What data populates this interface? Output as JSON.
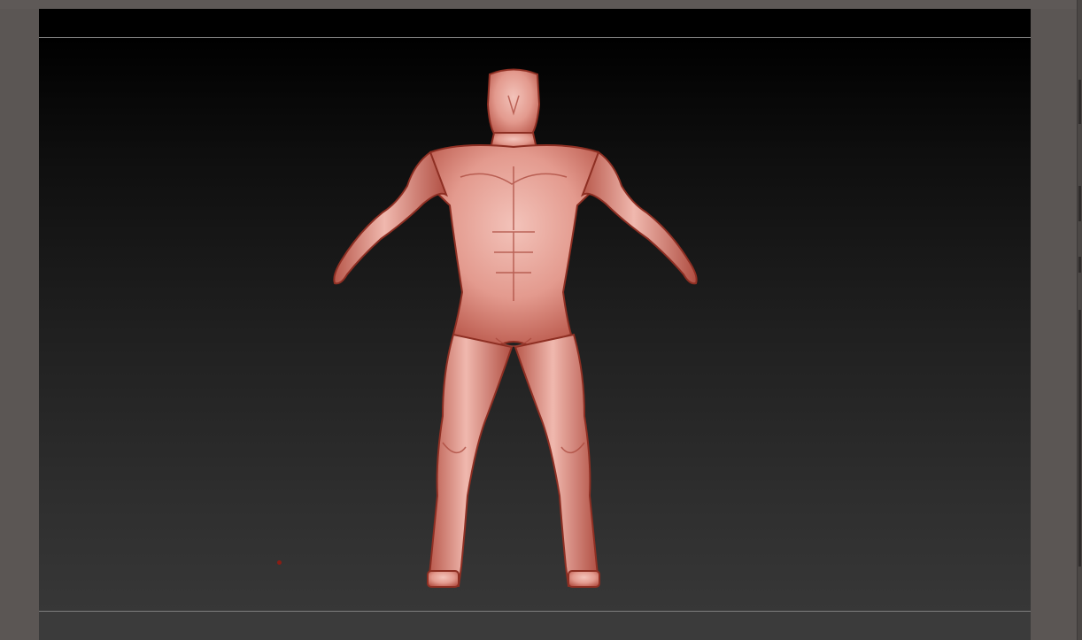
{
  "app": {
    "window_title": "",
    "accent_color": "#8d8d8d"
  },
  "viewport": {
    "model": "muscular-humanoid-sculpt",
    "material_color": "#e8a298",
    "shadow_color": "#9b3a2e",
    "background_top": "#000000",
    "background_bottom": "#373737"
  }
}
